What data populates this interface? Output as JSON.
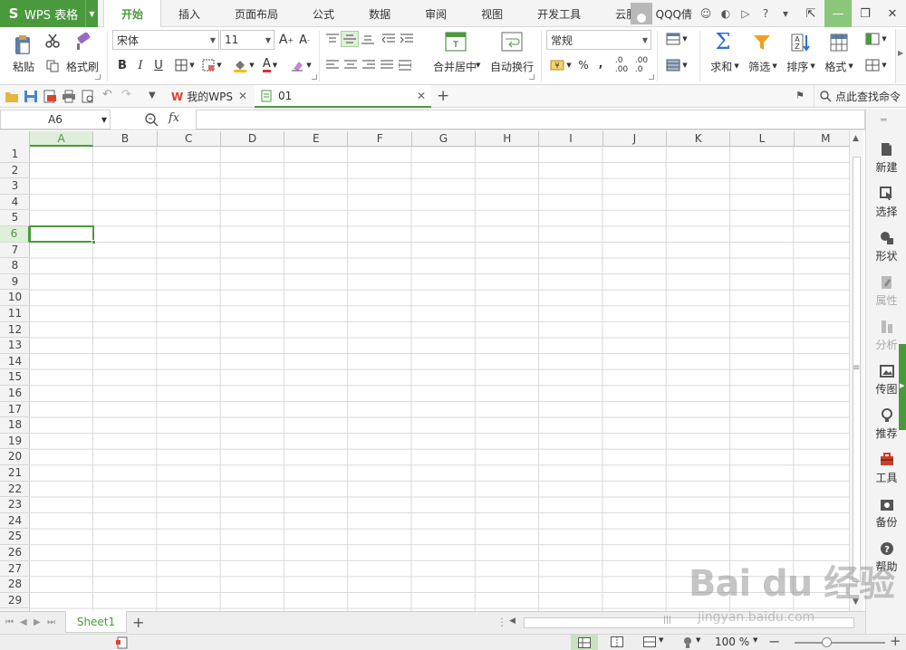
{
  "app": {
    "logo_letter": "S",
    "name": "WPS 表格",
    "brand_color": "#4a9a3d"
  },
  "tabs": [
    "开始",
    "插入",
    "页面布局",
    "公式",
    "数据",
    "审阅",
    "视图",
    "开发工具",
    "云服务"
  ],
  "user": {
    "name": "QQQ倩"
  },
  "ribbon": {
    "paste_label": "粘贴",
    "format_painter_label": "格式刷",
    "font_name": "宋体",
    "font_size": "11",
    "bold": "B",
    "italic": "I",
    "underline": "U",
    "merge_label": "合并居中",
    "wrap_label": "自动换行",
    "number_format": "常规",
    "percent": "%",
    "comma": ",",
    "sum_label": "求和",
    "filter_label": "筛选",
    "sort_label": "排序",
    "format_label": "格式"
  },
  "quickbar": {
    "doc_tabs": [
      {
        "label": "我的WPS"
      },
      {
        "label": "01"
      }
    ],
    "search_label": "点此查找命令"
  },
  "formula_bar": {
    "name_box": "A6",
    "fx": "fx",
    "formula": ""
  },
  "grid": {
    "columns": [
      "A",
      "B",
      "C",
      "D",
      "E",
      "F",
      "G",
      "H",
      "I",
      "J",
      "K",
      "L",
      "M"
    ],
    "rows": [
      "1",
      "2",
      "3",
      "4",
      "5",
      "6",
      "7",
      "8",
      "9",
      "10",
      "11",
      "12",
      "13",
      "14",
      "15",
      "16",
      "17",
      "18",
      "19",
      "20",
      "21",
      "22",
      "23",
      "24",
      "25",
      "26",
      "27",
      "28",
      "29"
    ],
    "active_column": "A",
    "active_row": "6"
  },
  "sheets": [
    "Sheet1"
  ],
  "status": {
    "zoom": "100 %"
  },
  "sidebar": {
    "items": [
      {
        "label": "新建",
        "icon": "new-icon",
        "dim": false
      },
      {
        "label": "选择",
        "icon": "select-icon",
        "dim": false
      },
      {
        "label": "形状",
        "icon": "shape-icon",
        "dim": false
      },
      {
        "label": "属性",
        "icon": "properties-icon",
        "dim": true
      },
      {
        "label": "分析",
        "icon": "analysis-icon",
        "dim": true
      },
      {
        "label": "传图",
        "icon": "upload-image-icon",
        "dim": false
      },
      {
        "label": "推荐",
        "icon": "recommend-icon",
        "dim": false
      },
      {
        "label": "工具",
        "icon": "toolbox-icon",
        "dim": false
      },
      {
        "label": "备份",
        "icon": "backup-icon",
        "dim": false
      },
      {
        "label": "帮助",
        "icon": "help-icon",
        "dim": false
      }
    ]
  },
  "watermark": {
    "brand": "Bai du 经验",
    "url": "jingyan.baidu.com"
  }
}
